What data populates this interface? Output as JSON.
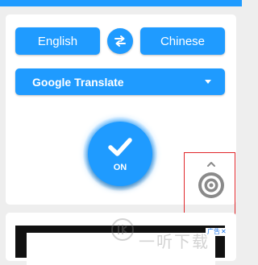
{
  "header": {
    "accent_color": "#1f9bff"
  },
  "language_bar": {
    "source_language": "English",
    "target_language": "Chinese",
    "swap_icon": "swap-horizontal-icon"
  },
  "engine_selector": {
    "selected": "Google Translate",
    "dropdown_icon": "caret-down-icon"
  },
  "power_button": {
    "label": "ON",
    "icon": "checkmark-icon"
  },
  "floating_button": {
    "icon": "target-icon",
    "highlight_color": "#e0262a"
  },
  "ad": {
    "badge_label": "广告",
    "close_label": "✕"
  },
  "watermark": {
    "text": "一听下载"
  }
}
